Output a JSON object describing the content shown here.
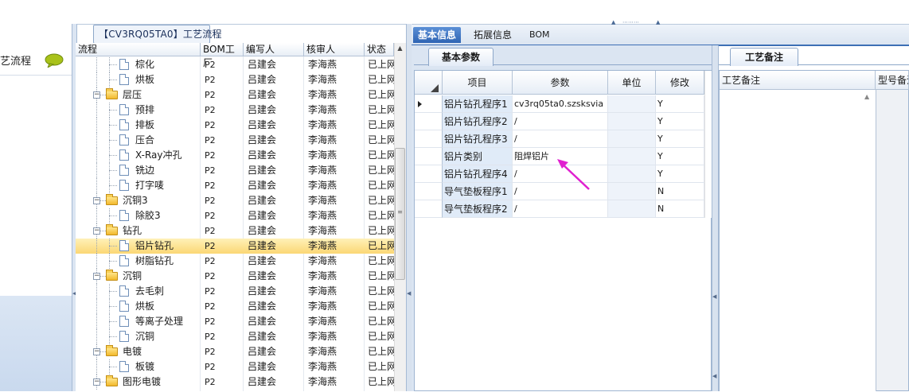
{
  "left_pane": {
    "title": "艺流程",
    "icon": "speech-bubble-icon"
  },
  "process_tab": {
    "label": "【CV3RQ05TA0】工艺流程"
  },
  "tree": {
    "columns": [
      "流程",
      "BOM工厂",
      "编写人",
      "核审人",
      "状态"
    ],
    "rows": [
      {
        "name": "棕化",
        "factory": "P2",
        "writer": "吕建会",
        "reviewer": "李海燕",
        "status": "已上网",
        "type": "doc",
        "level": 2
      },
      {
        "name": "烘板",
        "factory": "P2",
        "writer": "吕建会",
        "reviewer": "李海燕",
        "status": "已上网",
        "type": "doc",
        "level": 2
      },
      {
        "name": "层压",
        "factory": "P2",
        "writer": "吕建会",
        "reviewer": "李海燕",
        "status": "已上网",
        "type": "folder",
        "level": 1
      },
      {
        "name": "预排",
        "factory": "P2",
        "writer": "吕建会",
        "reviewer": "李海燕",
        "status": "已上网",
        "type": "doc",
        "level": 2
      },
      {
        "name": "排板",
        "factory": "P2",
        "writer": "吕建会",
        "reviewer": "李海燕",
        "status": "已上网",
        "type": "doc",
        "level": 2
      },
      {
        "name": "压合",
        "factory": "P2",
        "writer": "吕建会",
        "reviewer": "李海燕",
        "status": "已上网",
        "type": "doc",
        "level": 2
      },
      {
        "name": "X-Ray冲孔",
        "factory": "P2",
        "writer": "吕建会",
        "reviewer": "李海燕",
        "status": "已上网",
        "type": "doc",
        "level": 2
      },
      {
        "name": "铣边",
        "factory": "P2",
        "writer": "吕建会",
        "reviewer": "李海燕",
        "status": "已上网",
        "type": "doc",
        "level": 2
      },
      {
        "name": "打字唛",
        "factory": "P2",
        "writer": "吕建会",
        "reviewer": "李海燕",
        "status": "已上网",
        "type": "doc",
        "level": 2
      },
      {
        "name": "沉铜3",
        "factory": "P2",
        "writer": "吕建会",
        "reviewer": "李海燕",
        "status": "已上网",
        "type": "folder",
        "level": 1
      },
      {
        "name": "除胶3",
        "factory": "P2",
        "writer": "吕建会",
        "reviewer": "李海燕",
        "status": "已上网",
        "type": "doc",
        "level": 2
      },
      {
        "name": "钻孔",
        "factory": "P2",
        "writer": "吕建会",
        "reviewer": "李海燕",
        "status": "已上网",
        "type": "folder",
        "level": 1
      },
      {
        "name": "铝片钻孔",
        "factory": "P2",
        "writer": "吕建会",
        "reviewer": "李海燕",
        "status": "已上网",
        "type": "doc",
        "level": 2,
        "selected": true
      },
      {
        "name": "树脂钻孔",
        "factory": "P2",
        "writer": "吕建会",
        "reviewer": "李海燕",
        "status": "已上网",
        "type": "doc",
        "level": 2
      },
      {
        "name": "沉铜",
        "factory": "P2",
        "writer": "吕建会",
        "reviewer": "李海燕",
        "status": "已上网",
        "type": "folder",
        "level": 1
      },
      {
        "name": "去毛刺",
        "factory": "P2",
        "writer": "吕建会",
        "reviewer": "李海燕",
        "status": "已上网",
        "type": "doc",
        "level": 2
      },
      {
        "name": "烘板",
        "factory": "P2",
        "writer": "吕建会",
        "reviewer": "李海燕",
        "status": "已上网",
        "type": "doc",
        "level": 2
      },
      {
        "name": "等离子处理",
        "factory": "P2",
        "writer": "吕建会",
        "reviewer": "李海燕",
        "status": "已上网",
        "type": "doc",
        "level": 2
      },
      {
        "name": "沉铜",
        "factory": "P2",
        "writer": "吕建会",
        "reviewer": "李海燕",
        "status": "已上网",
        "type": "doc",
        "level": 2
      },
      {
        "name": "电镀",
        "factory": "P2",
        "writer": "吕建会",
        "reviewer": "李海燕",
        "status": "已上网",
        "type": "folder",
        "level": 1
      },
      {
        "name": "板镀",
        "factory": "P2",
        "writer": "吕建会",
        "reviewer": "李海燕",
        "status": "已上网",
        "type": "doc",
        "level": 2
      },
      {
        "name": "图形电镀",
        "factory": "P2",
        "writer": "吕建会",
        "reviewer": "李海燕",
        "status": "已上网",
        "type": "folder",
        "level": 1
      }
    ]
  },
  "tabs": [
    {
      "label": "基本信息",
      "active": true
    },
    {
      "label": "拓展信息",
      "active": false
    },
    {
      "label": "BOM",
      "active": false
    }
  ],
  "basic_params": {
    "tab_label": "基本参数",
    "columns": [
      "项目",
      "参数",
      "单位",
      "修改"
    ],
    "rows": [
      {
        "item": "铝片钻孔程序1",
        "param": "cv3rq05ta0.szsksvia",
        "unit": "",
        "modify": "Y",
        "current": true
      },
      {
        "item": "铝片钻孔程序2",
        "param": "/",
        "unit": "",
        "modify": "Y"
      },
      {
        "item": "铝片钻孔程序3",
        "param": "/",
        "unit": "",
        "modify": "Y"
      },
      {
        "item": "铝片类别",
        "param": "阻焊铝片",
        "unit": "",
        "modify": "Y"
      },
      {
        "item": "铝片钻孔程序4",
        "param": "/",
        "unit": "",
        "modify": "Y"
      },
      {
        "item": "导气垫板程序1",
        "param": "/",
        "unit": "",
        "modify": "N"
      },
      {
        "item": "导气垫板程序2",
        "param": "/",
        "unit": "",
        "modify": "N"
      }
    ]
  },
  "process_remark": {
    "tab_label": "工艺备注",
    "columns": [
      "工艺备注",
      "型号备注"
    ]
  },
  "colors": {
    "accent_tab": "#2f64b3",
    "selected_row": "#fbd774",
    "annotation_arrow": "#e020d0"
  }
}
